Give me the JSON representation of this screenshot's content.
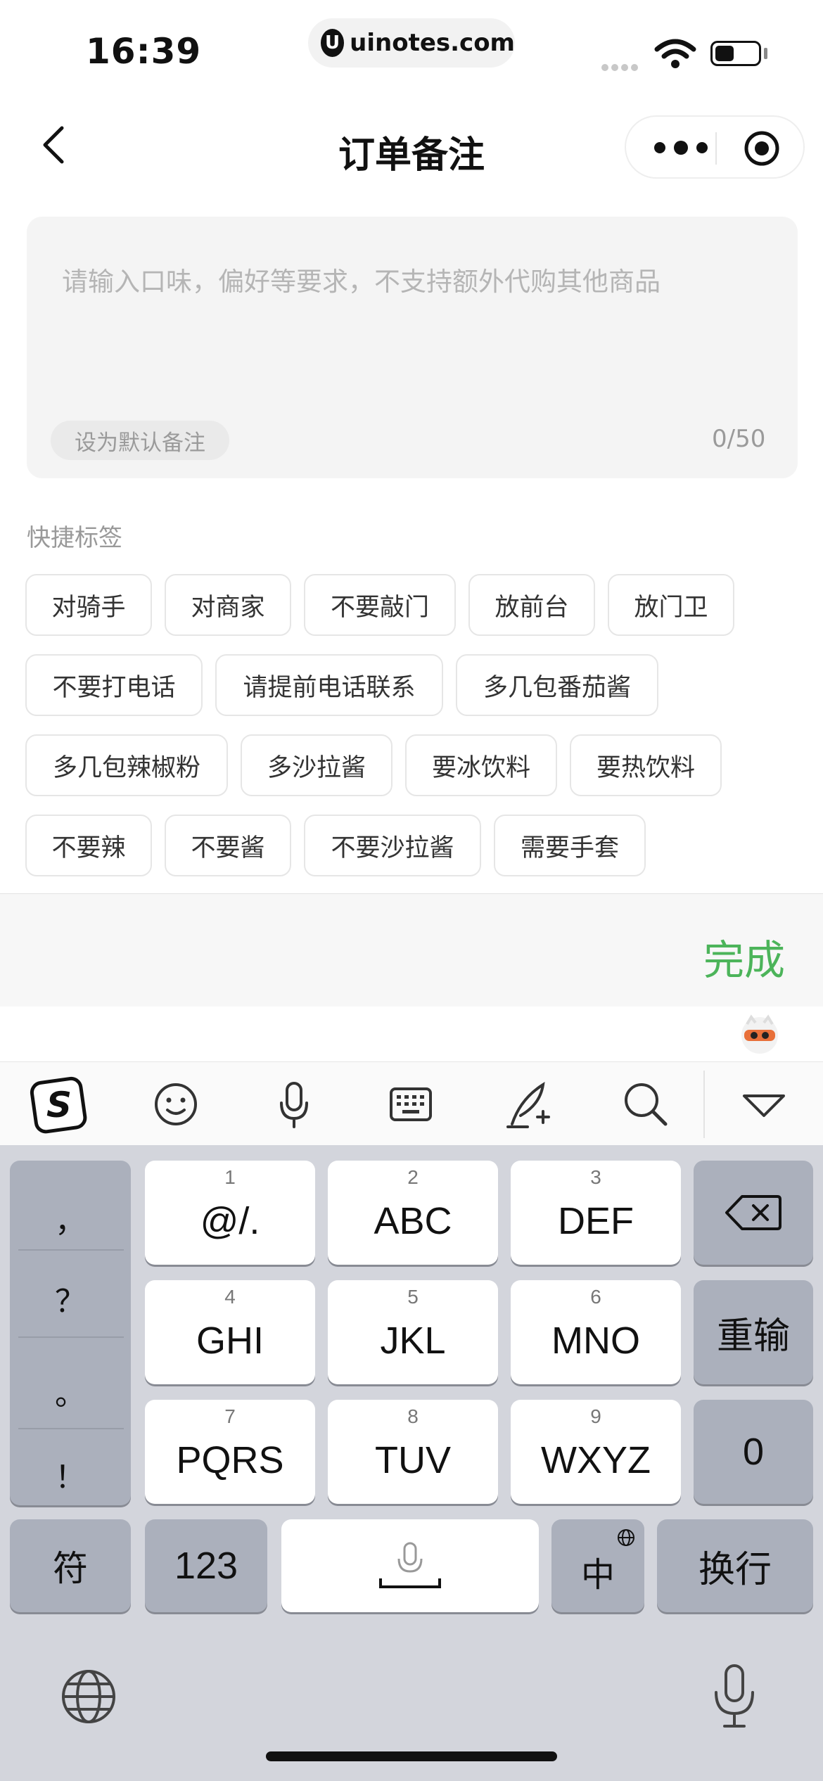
{
  "status_bar": {
    "time": "16:39",
    "url": "uinotes.com"
  },
  "nav": {
    "title": "订单备注",
    "back_icon": "chevron-left-icon",
    "more_icon": "more-dots-icon",
    "close_icon": "target-icon"
  },
  "note": {
    "placeholder": "请输入口味，偏好等要求，不支持额外代购其他商品",
    "default_label": "设为默认备注",
    "count": "0/50"
  },
  "quick_tags": {
    "label": "快捷标签",
    "rows": [
      [
        "对骑手",
        "对商家",
        "不要敲门",
        "放前台",
        "放门卫"
      ],
      [
        "不要打电话",
        "请提前电话联系",
        "多几包番茄酱"
      ],
      [
        "多几包辣椒粉",
        "多沙拉酱",
        "要冰饮料",
        "要热饮料"
      ],
      [
        "不要辣",
        "不要酱",
        "不要沙拉酱",
        "需要手套"
      ]
    ]
  },
  "done_label": "完成",
  "keyboard": {
    "punctuation": [
      "，",
      "？",
      "。",
      "！"
    ],
    "keys": [
      {
        "num": "1",
        "label": "@/."
      },
      {
        "num": "2",
        "label": "ABC"
      },
      {
        "num": "3",
        "label": "DEF"
      },
      {
        "num": "4",
        "label": "GHI"
      },
      {
        "num": "5",
        "label": "JKL"
      },
      {
        "num": "6",
        "label": "MNO"
      },
      {
        "num": "7",
        "label": "PQRS"
      },
      {
        "num": "8",
        "label": "TUV"
      },
      {
        "num": "9",
        "label": "WXYZ"
      }
    ],
    "reenter_label": "重输",
    "zero_label": "0",
    "symbol_label": "符",
    "numeric_label": "123",
    "chinese_label": "中",
    "newline_label": "换行"
  }
}
